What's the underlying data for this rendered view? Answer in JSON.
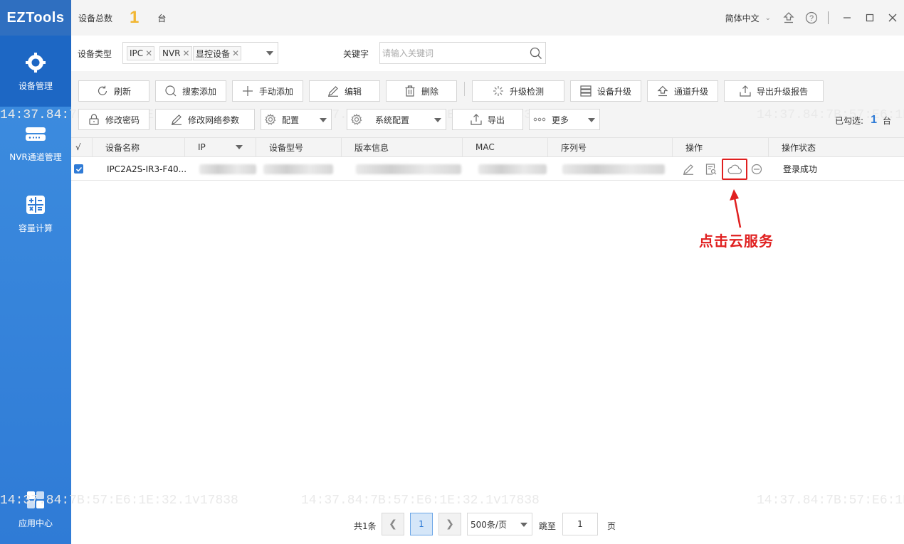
{
  "app": {
    "logo": "EZTools"
  },
  "sidebar": {
    "items": [
      {
        "label": "设备管理",
        "icon": "gear-icon",
        "active": true
      },
      {
        "label": "NVR通道管理",
        "icon": "nvr-device-icon",
        "active": false
      },
      {
        "label": "容量计算",
        "icon": "calculator-icon",
        "active": false
      },
      {
        "label": "应用中心",
        "icon": "app-grid-icon",
        "active": false
      }
    ]
  },
  "topbar": {
    "device_total_label": "设备总数",
    "device_total_count": "1",
    "unit": "台",
    "language": "简体中文"
  },
  "filter": {
    "device_type_label": "设备类型",
    "tags": [
      "IPC",
      "NVR",
      "显控设备"
    ],
    "keyword_label": "关键字",
    "keyword_placeholder": "请输入关键词"
  },
  "toolbar": {
    "row1": [
      "刷新",
      "搜索添加",
      "手动添加",
      "编辑",
      "删除",
      "升级检测",
      "设备升级",
      "通道升级",
      "导出升级报告"
    ],
    "row2": [
      "修改密码",
      "修改网络参数",
      "配置",
      "系统配置",
      "导出",
      "更多"
    ],
    "selected_label": "已勾选:",
    "selected_count": "1",
    "selected_unit": "台"
  },
  "watermark": "14:37.84:7B:57:E6:1E:32.1v17838",
  "table": {
    "headers": [
      "√",
      "设备名称",
      "IP",
      "设备型号",
      "版本信息",
      "MAC",
      "序列号",
      "操作",
      "操作状态"
    ],
    "rows": [
      {
        "checked": true,
        "name": "IPC2A2S-IR3-F40...",
        "status": "登录成功"
      }
    ]
  },
  "annotation": {
    "text": "点击云服务",
    "color": "#e02020"
  },
  "pager": {
    "total": "共1条",
    "current_page": "1",
    "page_size": "500条/页",
    "jump_label": "跳至",
    "jump_value": "1",
    "page_label": "页"
  },
  "colors": {
    "sidebar": "#2f7bd6",
    "accent": "#2f7bd6",
    "count": "#f2b632",
    "annotation": "#e02020"
  }
}
